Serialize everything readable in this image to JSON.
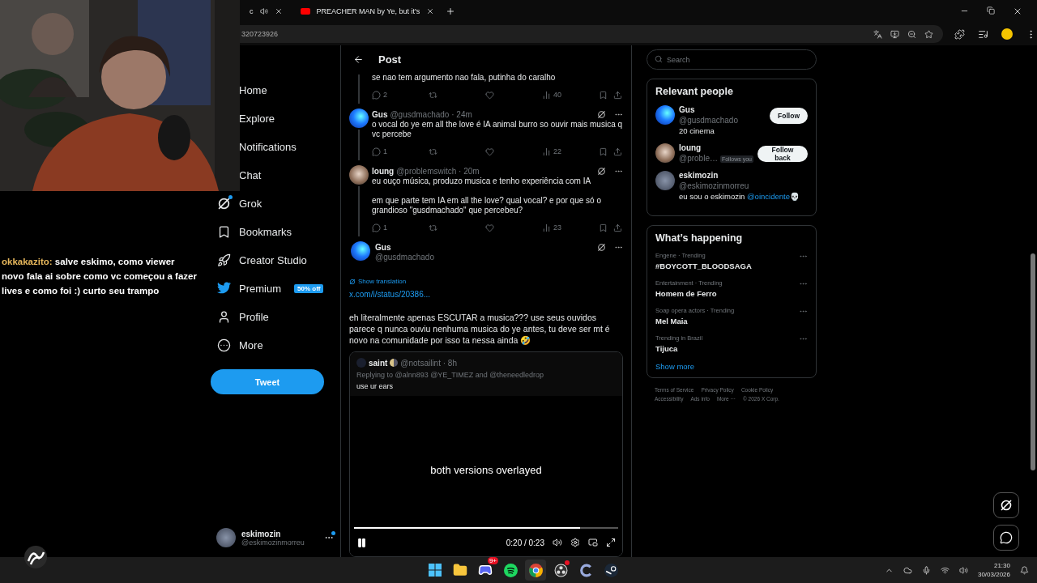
{
  "browser": {
    "tabs": [
      {
        "title": "c",
        "audio": true
      },
      {
        "title": "PREACHER MAN by Ye, but it's",
        "audio": false
      }
    ],
    "address": "320723926"
  },
  "stream": {
    "chat": {
      "user": "okkakazito:",
      "message": "salve eskimo, como viewer novo fala ai sobre como vc começou a fazer lives e como foi :) curto seu trampo"
    }
  },
  "nav": {
    "items": [
      {
        "label": "Home",
        "kind": "covered"
      },
      {
        "label": "Explore",
        "kind": "covered"
      },
      {
        "label": "Notifications",
        "kind": "covered"
      },
      {
        "label": "Chat",
        "kind": "covered"
      },
      {
        "label": "Grok",
        "kind": "grok",
        "dot": true
      },
      {
        "label": "Bookmarks",
        "kind": "bookmark"
      },
      {
        "label": "Creator Studio",
        "kind": "rocket"
      },
      {
        "label": "Premium",
        "kind": "bird",
        "badge": "50% off"
      },
      {
        "label": "Profile",
        "kind": "user"
      },
      {
        "label": "More",
        "kind": "more"
      }
    ],
    "tweet_button": "Tweet",
    "account": {
      "name": "eskimozin",
      "handle": "@eskimozinmorreu",
      "dot": true
    }
  },
  "post": {
    "title": "Post",
    "thread": [
      {
        "kind": "partial",
        "text": "se nao tem argumento nao fala, putinha do caralho",
        "replies": "2",
        "views": "40"
      },
      {
        "kind": "reply",
        "avatar": {
          "kind": "gradient"
        },
        "name": "Gus",
        "handle": "@gusdmachado",
        "time": "· 24m",
        "text": "o vocal do ye em all the love é IA animal burro so ouvir mais musica q vc percebe",
        "replies": "1",
        "views": "22"
      },
      {
        "kind": "reply",
        "name": "loung",
        "handle": "@problemswitch",
        "time": "· 20m",
        "text": "eu ouço música, produzo musica e tenho experiência com IA\n\nem que parte tem IA em all the love? qual vocal? e por que só o grandioso \"gusdmachado\" que percebeu?",
        "replies": "1",
        "views": "23"
      }
    ],
    "main": {
      "name": "Gus",
      "handle": "@gusdmachado",
      "translate": "Show translation",
      "link": "x.com/i/status/20386...",
      "text": "eh literalmente apenas ESCUTAR a musica??? use seus ouvidos parece q nunca ouviu nenhuma musica do ye antes, tu deve ser mt é novo na comunidade por isso ta nessa ainda 🤣",
      "quote": {
        "name": "saint",
        "handle": "@notsailint",
        "time": "· 8h",
        "replying": "Replying to @alnn893 @YE_TIMEZ and @theneedledrop",
        "text": "use ur ears",
        "caption": "both versions overlayed",
        "playing": true,
        "level": 0.857,
        "time_reading": "0:20 / 0:23"
      }
    }
  },
  "sidebar": {
    "search": {
      "placeholder": "Search"
    },
    "people": {
      "title": "Relevant people",
      "items": [
        {
          "avatar": {
            "kind": "gradient"
          },
          "name": "Gus",
          "handle": "@gusdmachado",
          "bio": "20 cinema",
          "button": "Follow"
        },
        {
          "name": "loung",
          "handle": "@proble…",
          "follows_you": "Follows you",
          "button": "Follow back"
        },
        {
          "avatar": {
            "kind": "grey"
          },
          "name": "eskimozin",
          "handle": "@eskimozinmorreu",
          "bio": "eu sou o eskimozin ",
          "mention": "@oincidente",
          "emoji": "💀"
        }
      ]
    },
    "trends": {
      "title": "What’s happening",
      "items": [
        {
          "context": "Engene · Trending",
          "topic": "#BOYCOTT_BLOODSAGA"
        },
        {
          "context": "Entertainment · Trending",
          "topic": "Homem de Ferro"
        },
        {
          "context": "Soap opera actors · Trending",
          "topic": "Mel Maia"
        },
        {
          "context": "Trending in Brazil",
          "topic": "Tijuca"
        }
      ],
      "more": "Show more"
    },
    "footer": [
      "Terms of Service",
      "Privacy Policy",
      "Cookie Policy",
      "Accessibility",
      "Ads info",
      "More ···",
      "© 2026 X Corp."
    ]
  },
  "taskbar": {
    "apps": [
      {
        "kind": "start",
        "active": false
      },
      {
        "kind": "folder",
        "active": false
      },
      {
        "kind": "discord",
        "badge": "9+",
        "active": false
      },
      {
        "kind": "spotify",
        "active": false
      },
      {
        "kind": "chrome",
        "active": true
      },
      {
        "kind": "obs",
        "alert": true,
        "active": false
      },
      {
        "kind": "cleaner",
        "active": false
      },
      {
        "kind": "steam",
        "active": false
      }
    ],
    "time": "21:30",
    "date": "30/03/2026"
  }
}
